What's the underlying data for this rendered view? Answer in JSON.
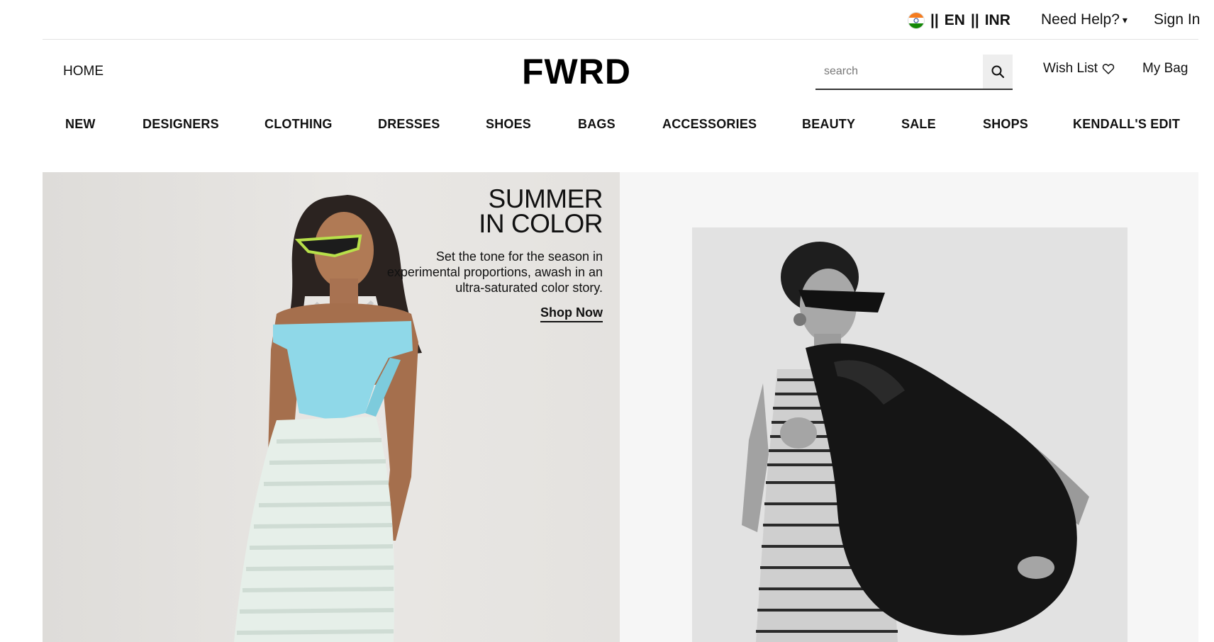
{
  "utility": {
    "locale": {
      "flag": "india-flag-icon",
      "separator": "||",
      "language": "EN",
      "currency": "INR"
    },
    "need_help": "Need Help?",
    "need_help_caret": "▾",
    "sign_in": "Sign In"
  },
  "header": {
    "home": "HOME",
    "logo": "FWRD",
    "search": {
      "placeholder": "search",
      "value": ""
    },
    "wishlist": "Wish List",
    "bag": "My Bag"
  },
  "nav": {
    "items": [
      "NEW",
      "DESIGNERS",
      "CLOTHING",
      "DRESSES",
      "SHOES",
      "BAGS",
      "ACCESSORIES",
      "BEAUTY",
      "SALE",
      "SHOPS",
      "KENDALL'S EDIT"
    ]
  },
  "hero": {
    "left": {
      "title_line1": "SUMMER",
      "title_line2": "IN COLOR",
      "description": "Set the tone for the season in experimental proportions, awash in an ultra-saturated color story.",
      "cta": "Shop Now"
    }
  },
  "colors": {
    "text": "#111111",
    "dress_accent": "#8fd8e8",
    "sunglasses_accent": "#b8e04a"
  }
}
